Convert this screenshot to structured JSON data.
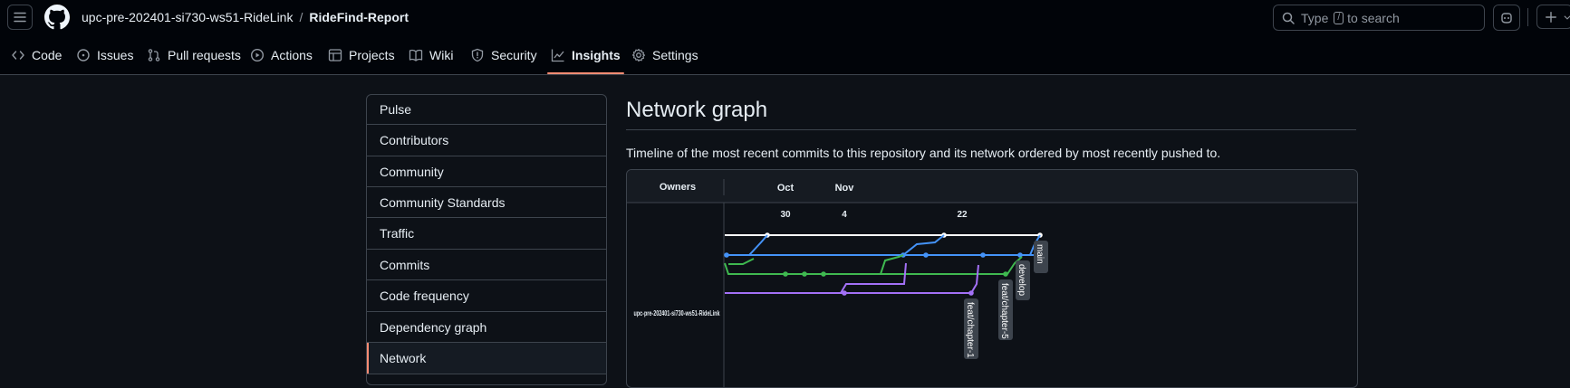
{
  "repo": {
    "owner": "upc-pre-202401-si730-ws51-RideLink",
    "separator": "/",
    "name": "RideFind-Report"
  },
  "search": {
    "prefix": "Type",
    "key": "/",
    "suffix": "to search"
  },
  "tabs": [
    {
      "label": "Code",
      "icon": "code-icon"
    },
    {
      "label": "Issues",
      "icon": "issue-icon"
    },
    {
      "label": "Pull requests",
      "icon": "pull-request-icon"
    },
    {
      "label": "Actions",
      "icon": "play-icon"
    },
    {
      "label": "Projects",
      "icon": "table-icon"
    },
    {
      "label": "Wiki",
      "icon": "book-icon"
    },
    {
      "label": "Security",
      "icon": "shield-icon"
    },
    {
      "label": "Insights",
      "icon": "graph-icon",
      "active": true
    },
    {
      "label": "Settings",
      "icon": "gear-icon"
    }
  ],
  "sidebar": {
    "items": [
      {
        "label": "Pulse"
      },
      {
        "label": "Contributors"
      },
      {
        "label": "Community"
      },
      {
        "label": "Community Standards"
      },
      {
        "label": "Traffic"
      },
      {
        "label": "Commits"
      },
      {
        "label": "Code frequency"
      },
      {
        "label": "Dependency graph"
      },
      {
        "label": "Network",
        "active": true
      }
    ]
  },
  "main": {
    "title": "Network graph",
    "description": "Timeline of the most recent commits to this repository and its network ordered by most recently pushed to."
  },
  "graph": {
    "owners_label": "Owners",
    "owner_name": "upc-pre-202401-si730-ws51-RideLink",
    "months": [
      "Oct",
      "Nov"
    ],
    "days": [
      "30",
      "4",
      "22"
    ],
    "branches": [
      {
        "name": "main",
        "color": "#ffffff"
      },
      {
        "name": "develop",
        "color": "#4493f8"
      },
      {
        "name": "feat/chapter-5",
        "color": "#3fb950"
      },
      {
        "name": "feat/chapter-1",
        "color": "#a371f7"
      }
    ]
  },
  "colors": {
    "accent": "#fd8c73",
    "background": "#0d1117",
    "header": "#010409",
    "border": "#3d444d"
  }
}
